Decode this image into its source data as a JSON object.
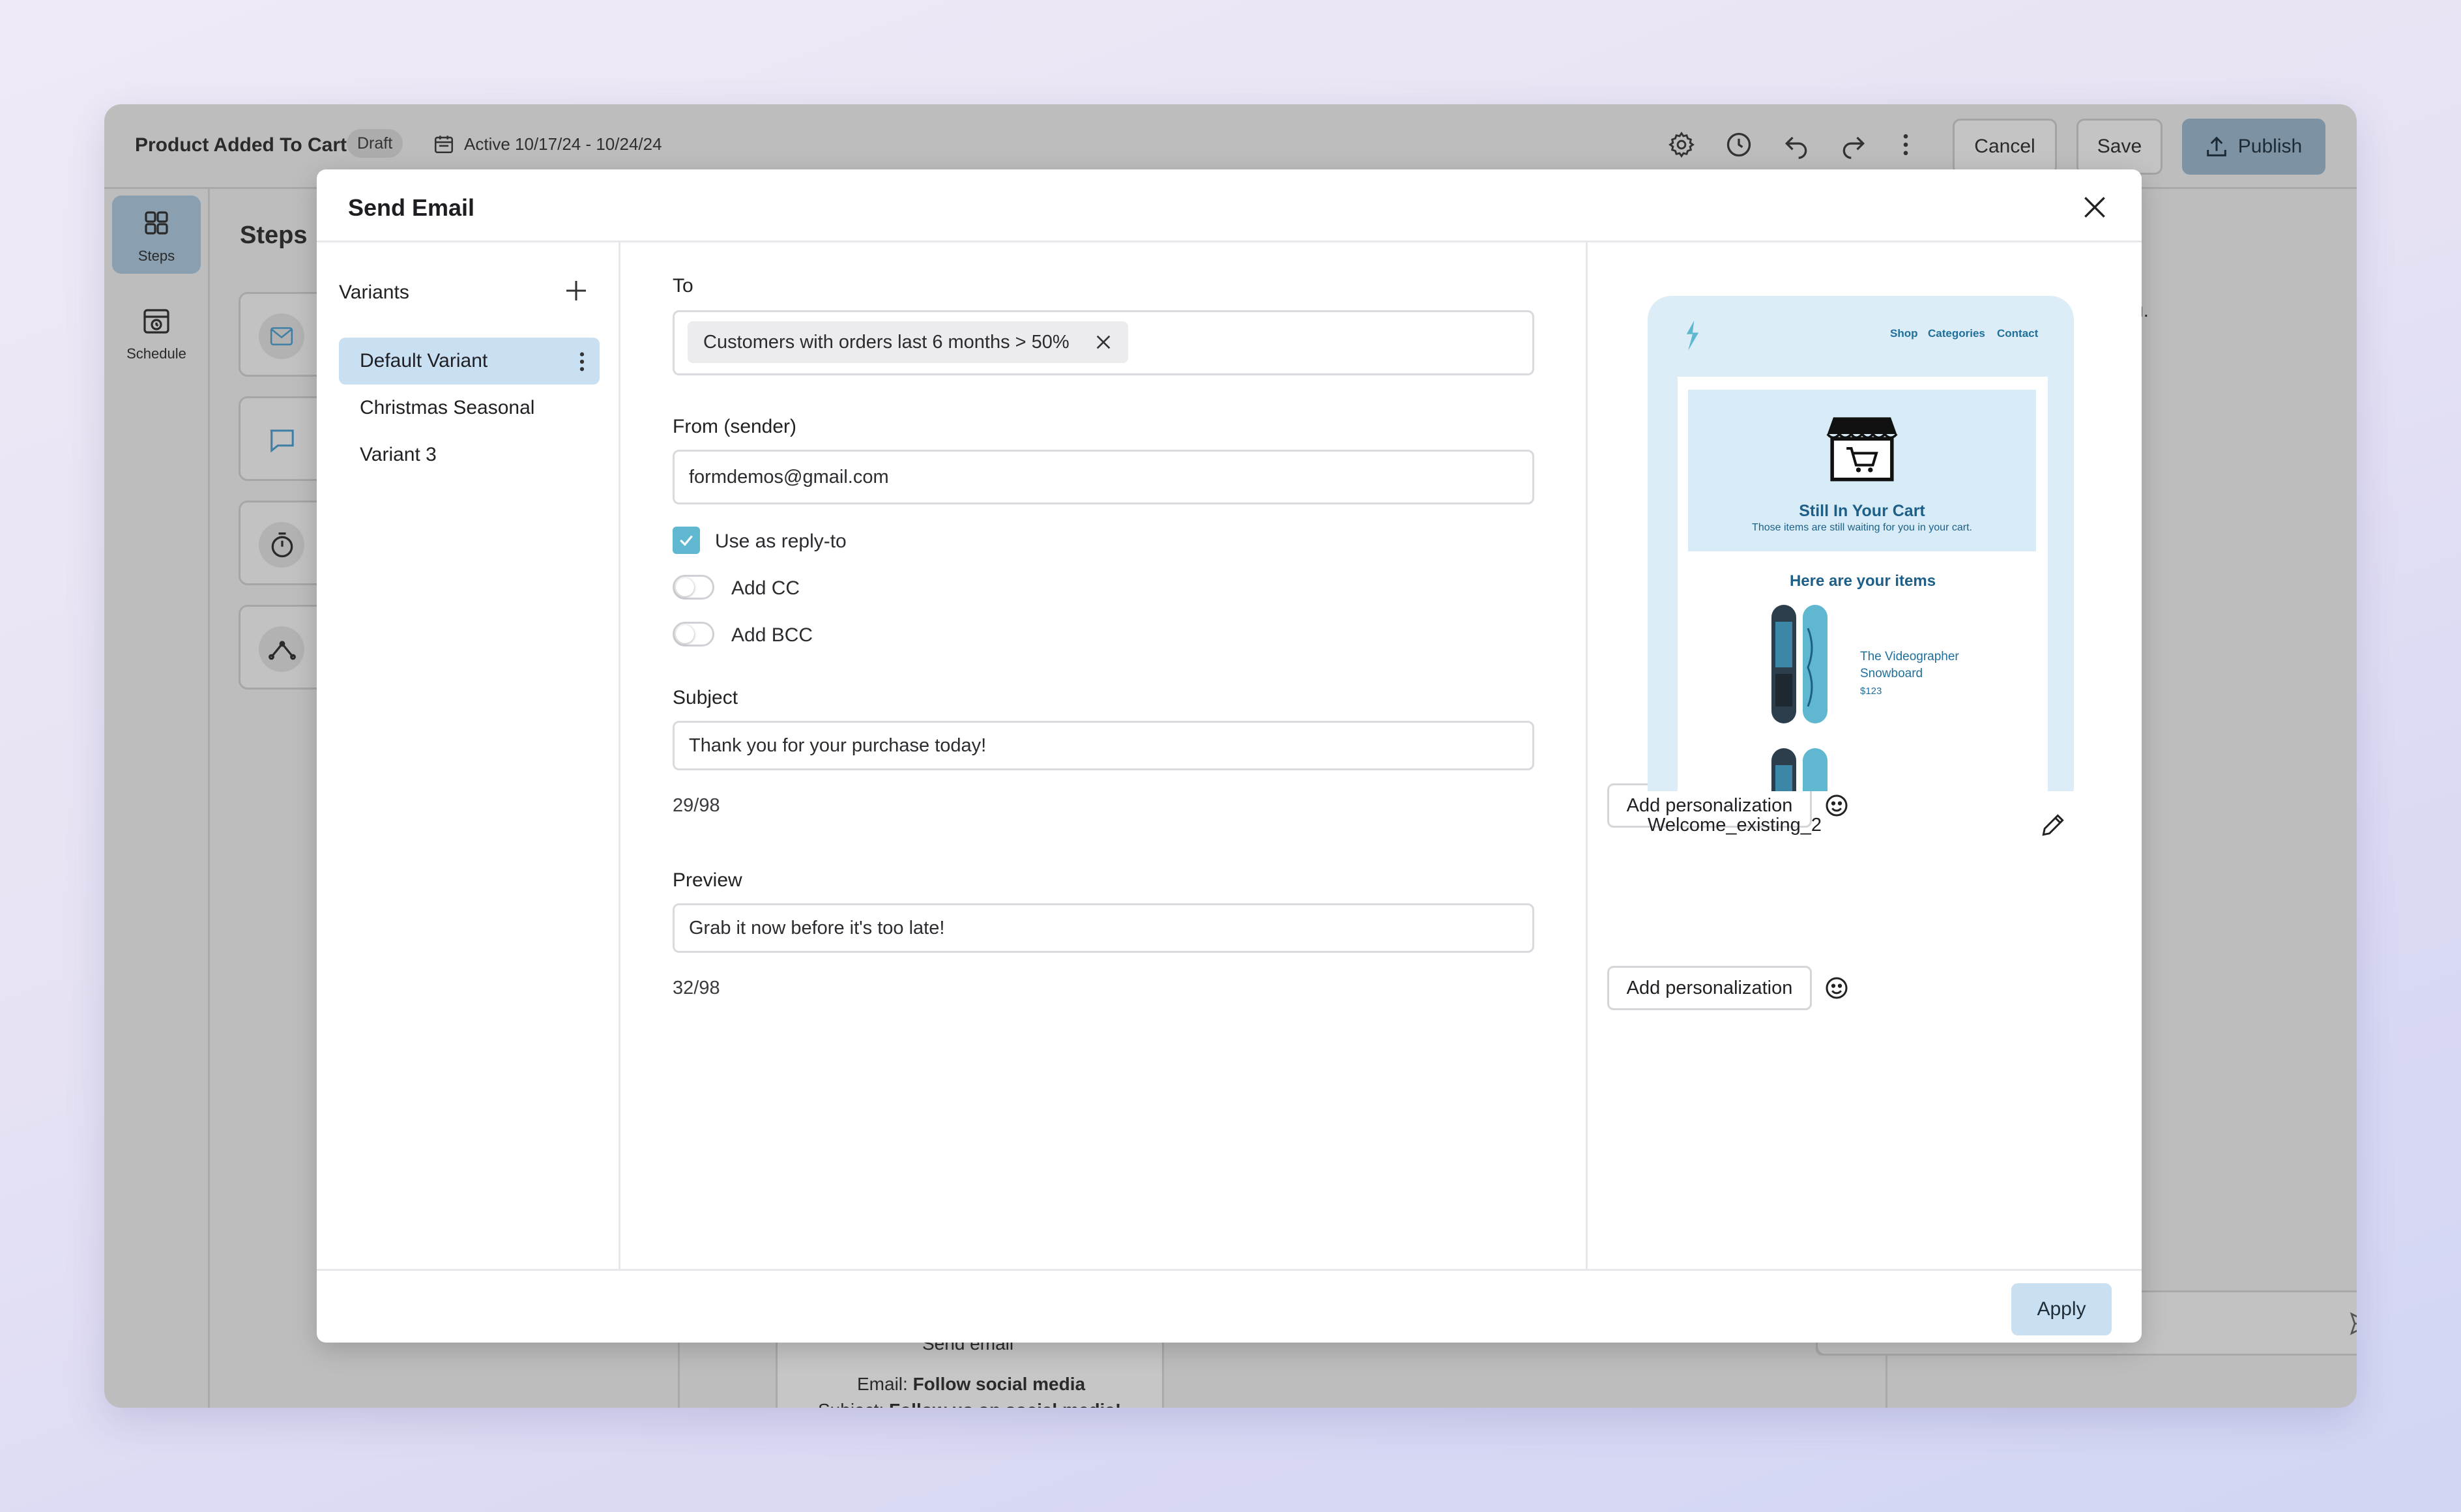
{
  "app": {
    "title": "Product Added To Cart",
    "status_badge": "Draft",
    "active_range": "Active 10/17/24 - 10/24/24",
    "buttons": {
      "cancel": "Cancel",
      "save": "Save",
      "publish": "Publish"
    },
    "icons": [
      "gear-icon",
      "history-icon",
      "undo-icon",
      "redo-icon",
      "more-vertical-icon",
      "upload-icon"
    ]
  },
  "rail": {
    "items": [
      {
        "label": "Steps",
        "icon": "grid-icon",
        "active": true
      },
      {
        "label": "Schedule",
        "icon": "calendar-clock-icon",
        "active": false
      }
    ]
  },
  "steps_panel": {
    "title": "Steps",
    "icons": [
      "mail-icon",
      "message-icon",
      "timer-icon",
      "split-icon"
    ]
  },
  "background": {
    "step_name": "Send email",
    "email_label": "Email:",
    "email_value": "Follow social media",
    "subject_label": "Subject:",
    "subject_value": "Follow us on social media!",
    "clipped_text": "u."
  },
  "modal": {
    "title": "Send Email",
    "variants": {
      "heading": "Variants",
      "items": [
        {
          "label": "Default Variant",
          "active": true
        },
        {
          "label": "Christmas Seasonal",
          "active": false
        },
        {
          "label": "Variant 3",
          "active": false
        }
      ]
    },
    "form": {
      "to_label": "To",
      "to_chip": "Customers with orders last 6 months > 50%",
      "from_label": "From (sender)",
      "from_value": "formdemos@gmail.com",
      "reply_to_label": "Use as reply-to",
      "reply_to_checked": true,
      "add_cc_label": "Add CC",
      "add_cc_on": false,
      "add_bcc_label": "Add BCC",
      "add_bcc_on": false,
      "subject_label": "Subject",
      "subject_value": "Thank you for your purchase today!",
      "subject_count": "29/98",
      "preview_label": "Preview",
      "preview_value": "Grab it now before it's too late!",
      "preview_count": "32/98",
      "personalization_button": "Add personalization"
    },
    "preview": {
      "nav": [
        "Shop",
        "Categories",
        "Contact"
      ],
      "hero_title": "Still In Your Cart",
      "hero_subtitle": "Those items are still waiting for you in your cart.",
      "items_heading": "Here are your items",
      "product_name": "The Videographer Snowboard",
      "product_price": "$123",
      "template_name": "Welcome_existing_2"
    },
    "apply_button": "Apply"
  },
  "colors": {
    "accent_light": "#c8e0f2",
    "checkbox": "#5fb8d0",
    "email_brand": "#1d5f86",
    "overlay_gray": "#bdbdbd"
  }
}
